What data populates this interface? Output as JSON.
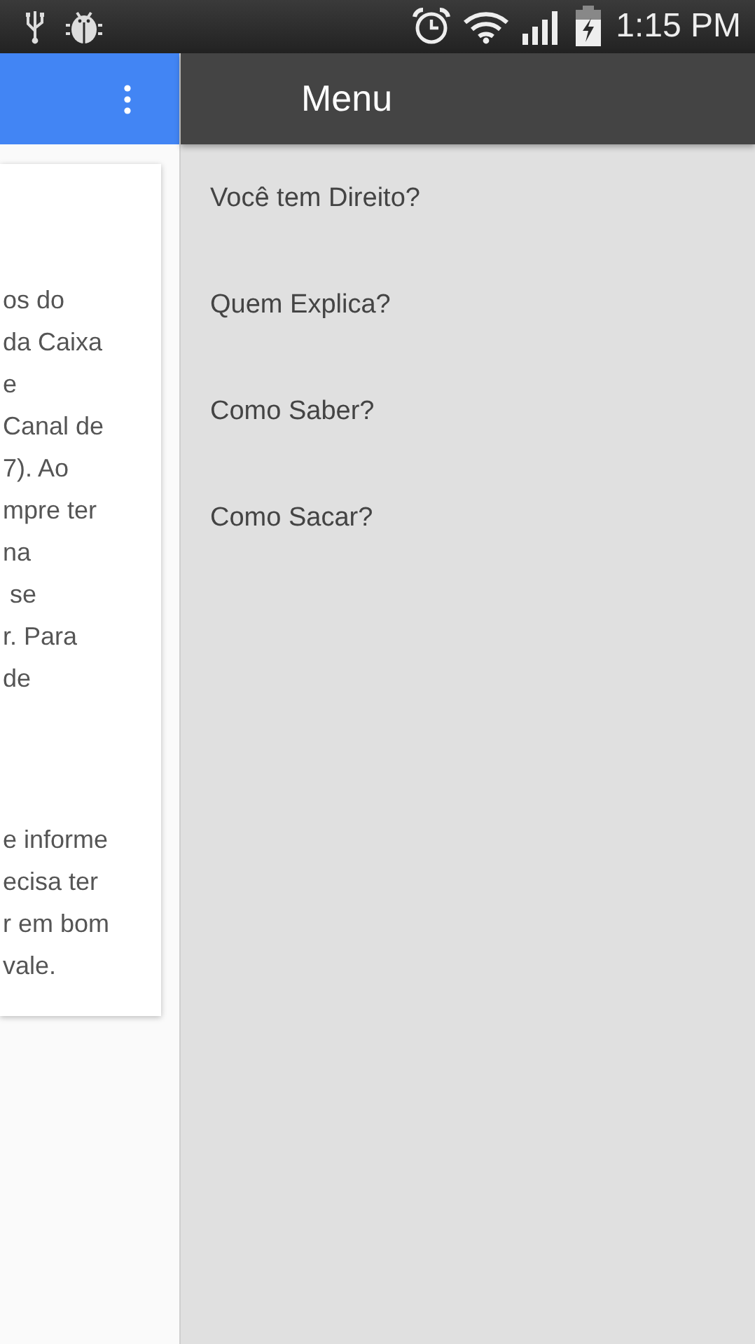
{
  "status_bar": {
    "time": "1:15 PM"
  },
  "content": {
    "paragraphs": [
      [
        "os do",
        "da Caixa",
        "e",
        "Canal de",
        "7). Ao",
        "mpre ter",
        "na",
        " se",
        "r. Para",
        "de"
      ],
      [
        "e informe",
        "ecisa ter",
        "r em bom",
        "vale."
      ]
    ]
  },
  "drawer": {
    "title": "Menu",
    "items": [
      {
        "label": "Você tem Direito?"
      },
      {
        "label": "Quem Explica?"
      },
      {
        "label": "Como Saber?"
      },
      {
        "label": "Como Sacar?"
      }
    ]
  }
}
